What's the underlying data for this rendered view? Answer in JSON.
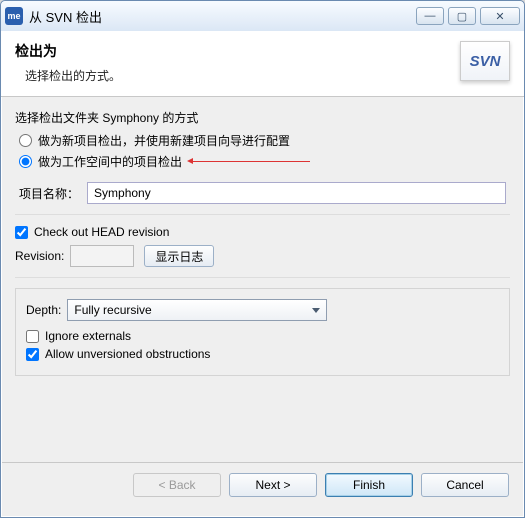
{
  "titlebar": {
    "app_icon_text": "me",
    "title": "从 SVN 检出"
  },
  "header": {
    "title": "检出为",
    "subtitle": "选择检出的方式。",
    "logo_text": "SVN"
  },
  "body": {
    "section_label": "选择检出文件夹 Symphony 的方式",
    "radio1": "做为新项目检出，并使用新建项目向导进行配置",
    "radio2": "做为工作空间中的项目检出",
    "radio_selected": "radio2",
    "project_name_label": "项目名称：",
    "project_name_value": "Symphony",
    "chk_head_label": "Check out HEAD revision",
    "chk_head_checked": true,
    "revision_label": "Revision:",
    "revision_value": "",
    "show_log_btn": "显示日志",
    "depth_label": "Depth:",
    "depth_value": "Fully recursive",
    "chk_ignore_label": "Ignore externals",
    "chk_ignore_checked": false,
    "chk_allow_label": "Allow unversioned obstructions",
    "chk_allow_checked": true
  },
  "buttons": {
    "back": "< Back",
    "next": "Next >",
    "finish": "Finish",
    "cancel": "Cancel"
  }
}
